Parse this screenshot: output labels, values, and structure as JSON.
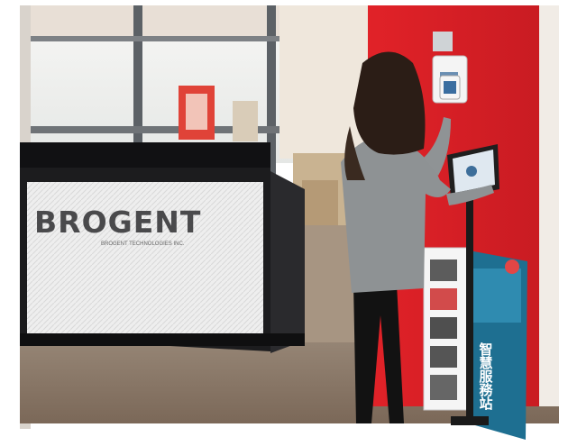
{
  "photo": {
    "reception_sign": {
      "brand": "BROGENT",
      "subtitle": "BROGENT TECHNOLOGIES INC."
    },
    "kiosk_banner": {
      "chinese_text": "智慧服務站"
    },
    "colors": {
      "red_wall": "#dc1f26",
      "counter_black": "#1c1c1e",
      "sign_panel": "#ededed",
      "floor": "#8a7868",
      "banner_teal": "#1e6f91",
      "sweater": "#8e9294",
      "hair": "#2b1d16",
      "window": "#f2f3f1"
    }
  }
}
